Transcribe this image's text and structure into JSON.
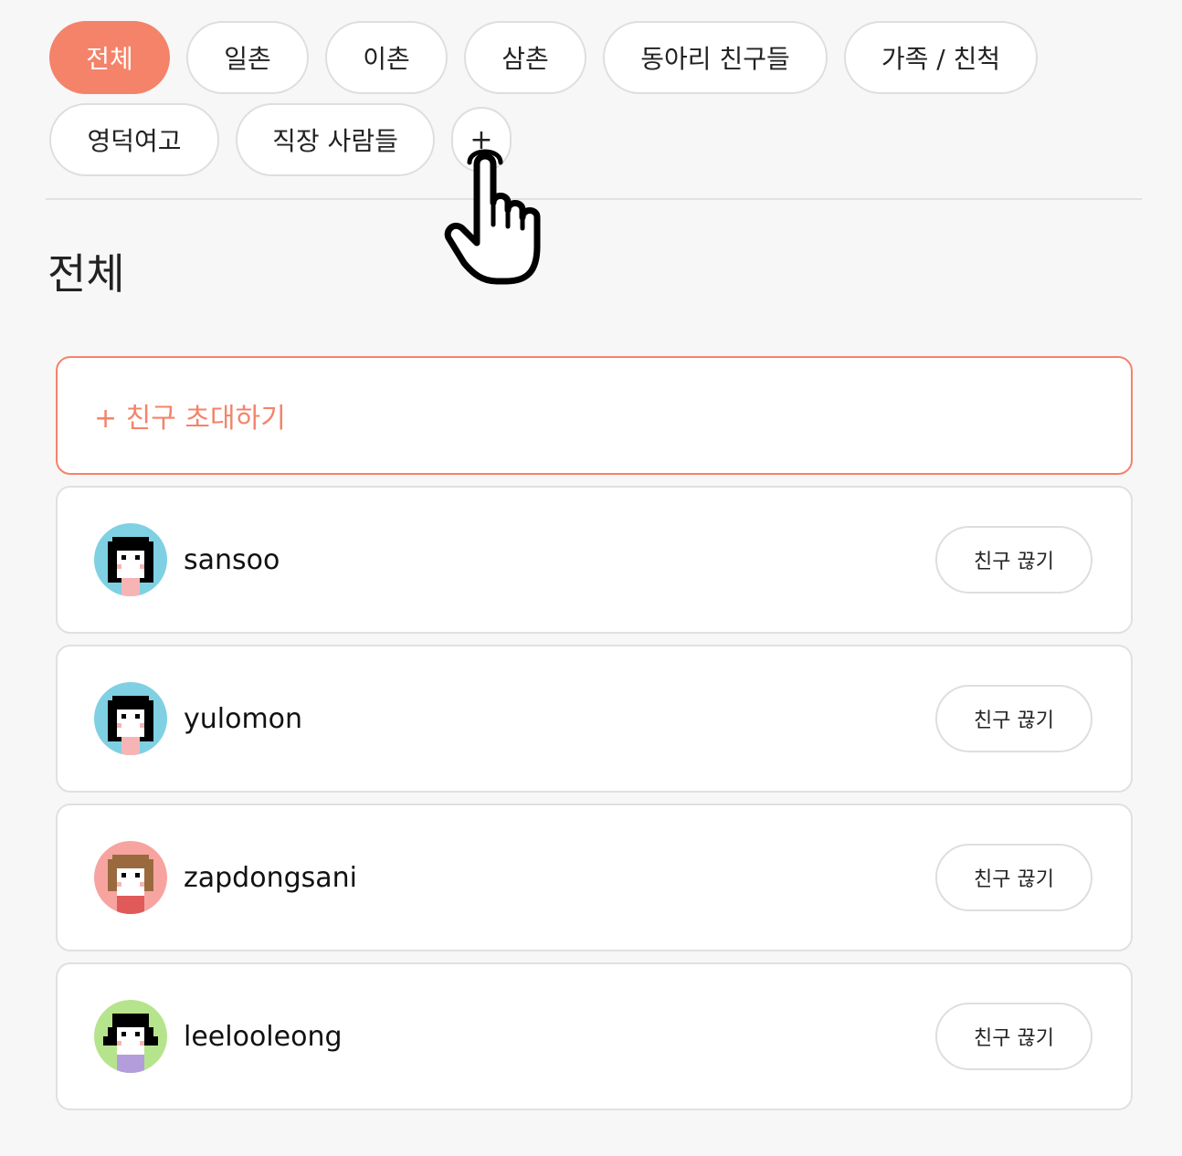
{
  "filters": {
    "items": [
      {
        "label": "전체"
      },
      {
        "label": "일촌"
      },
      {
        "label": "이촌"
      },
      {
        "label": "삼촌"
      },
      {
        "label": "동아리 친구들"
      },
      {
        "label": "가족 / 친척"
      },
      {
        "label": "영덕여고"
      },
      {
        "label": "직장 사람들"
      }
    ],
    "add_label": "+"
  },
  "section": {
    "title": "전체"
  },
  "invite": {
    "label": "+ 친구 초대하기"
  },
  "friends": [
    {
      "name": "sansoo",
      "action": "친구 끊기"
    },
    {
      "name": "yulomon",
      "action": "친구 끊기"
    },
    {
      "name": "zapdongsani",
      "action": "친구 끊기"
    },
    {
      "name": "leelooleong",
      "action": "친구 끊기"
    }
  ],
  "colors": {
    "accent": "#f4836a",
    "avatar_bg": [
      "#7fd0e3",
      "#7fd0e3",
      "#f7a4a0",
      "#b6e48c"
    ]
  }
}
